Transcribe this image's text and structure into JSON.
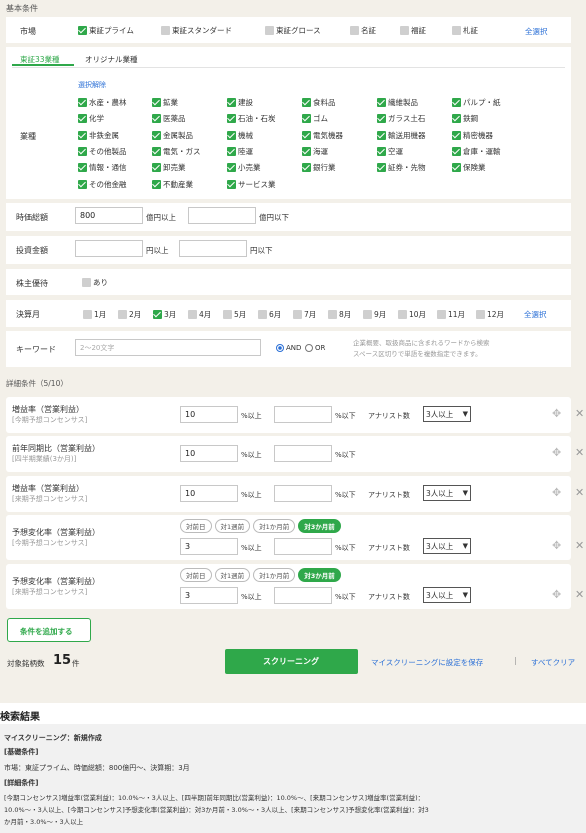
{
  "header": {
    "basic_conditions": "基本条件"
  },
  "market": {
    "label": "市場",
    "options": [
      {
        "label": "東証プライム",
        "checked": true
      },
      {
        "label": "東証スタンダード",
        "checked": false
      },
      {
        "label": "東証グロース",
        "checked": false
      },
      {
        "label": "名証",
        "checked": false
      },
      {
        "label": "福証",
        "checked": false
      },
      {
        "label": "札証",
        "checked": false
      }
    ],
    "select_all": "全選択"
  },
  "industry": {
    "tabs": [
      "東証33業種",
      "オリジナル業種"
    ],
    "deselect": "選択解除",
    "label": "業種",
    "items": [
      "水産・農林",
      "鉱業",
      "建設",
      "食料品",
      "繊維製品",
      "パルプ・紙",
      "化学",
      "医薬品",
      "石油・石炭",
      "ゴム",
      "ガラス土石",
      "鉄鋼",
      "非鉄金属",
      "金属製品",
      "機械",
      "電気機器",
      "輸送用機器",
      "精密機器",
      "その他製品",
      "電気・ガス",
      "陸運",
      "海運",
      "空運",
      "倉庫・運輸",
      "情報・通信",
      "卸売業",
      "小売業",
      "銀行業",
      "証券・先物",
      "保険業",
      "その他金融",
      "不動産業",
      "サービス業"
    ]
  },
  "market_cap": {
    "label": "時価総額",
    "min": "800",
    "min_unit": "億円以上",
    "max": "",
    "max_unit": "億円以下"
  },
  "investment": {
    "label": "投資金額",
    "min_unit": "円以上",
    "max_unit": "円以下"
  },
  "benefit": {
    "label": "株主優待",
    "option": "あり"
  },
  "fiscal_month": {
    "label": "決算月",
    "months": [
      {
        "label": "1月",
        "checked": false
      },
      {
        "label": "2月",
        "checked": false
      },
      {
        "label": "3月",
        "checked": true
      },
      {
        "label": "4月",
        "checked": false
      },
      {
        "label": "5月",
        "checked": false
      },
      {
        "label": "6月",
        "checked": false
      },
      {
        "label": "7月",
        "checked": false
      },
      {
        "label": "8月",
        "checked": false
      },
      {
        "label": "9月",
        "checked": false
      },
      {
        "label": "10月",
        "checked": false
      },
      {
        "label": "11月",
        "checked": false
      },
      {
        "label": "12月",
        "checked": false
      }
    ],
    "select_all": "全選択"
  },
  "keyword": {
    "label": "キーワード",
    "placeholder": "2～20文字",
    "and": "AND",
    "or": "OR",
    "note1": "企業概要、取扱商品に含まれるワードから検索",
    "note2": "スペース区切りで単語を複数指定できます。"
  },
  "details_header": "詳細条件（5/10）",
  "details": [
    {
      "title": "増益率（営業利益）",
      "sub": "[今期予想コンセンサス]",
      "min": "10",
      "min_unit": "%以上",
      "max_unit": "%以下",
      "analyst_label": "アナリスト数",
      "analyst": "3人以上",
      "pills": []
    },
    {
      "title": "前年同期比（営業利益）",
      "sub": "[四半期業績(3か月)]",
      "min": "10",
      "min_unit": "%以上",
      "max_unit": "%以下",
      "analyst_label": "",
      "analyst": "",
      "pills": []
    },
    {
      "title": "増益率（営業利益）",
      "sub": "[来期予想コンセンサス]",
      "min": "10",
      "min_unit": "%以上",
      "max_unit": "%以下",
      "analyst_label": "アナリスト数",
      "analyst": "3人以上",
      "pills": []
    },
    {
      "title": "予想変化率（営業利益）",
      "sub": "[今期予想コンセンサス]",
      "min": "3",
      "min_unit": "%以上",
      "max_unit": "%以下",
      "analyst_label": "アナリスト数",
      "analyst": "3人以上",
      "pills": [
        {
          "label": "対前日",
          "on": false
        },
        {
          "label": "対1週前",
          "on": false
        },
        {
          "label": "対1か月前",
          "on": false
        },
        {
          "label": "対3か月前",
          "on": true
        }
      ]
    },
    {
      "title": "予想変化率（営業利益）",
      "sub": "[来期予想コンセンサス]",
      "min": "3",
      "min_unit": "%以上",
      "max_unit": "%以下",
      "analyst_label": "アナリスト数",
      "analyst": "3人以上",
      "pills": [
        {
          "label": "対前日",
          "on": false
        },
        {
          "label": "対1週前",
          "on": false
        },
        {
          "label": "対1か月前",
          "on": false
        },
        {
          "label": "対3か月前",
          "on": true
        }
      ]
    }
  ],
  "add_condition": "条件を追加する",
  "target_count_label": "対象銘柄数",
  "target_count": "15",
  "target_count_unit": "件",
  "screening_button": "スクリーニング",
  "save_link": "マイスクリーニングに設定を保存",
  "separator": "|",
  "clear_link": "すべてクリア",
  "results": {
    "title": "検索結果",
    "my_screening": "マイスクリーニング：新規作成",
    "basic_head": "[基礎条件]",
    "basic_text": "市場：東証プライム、時価総額：800億円～、決算期：3月",
    "detail_head": "[詳細条件]",
    "detail_line1": "[今期コンセンサス]増益率(営業利益)：10.0%～・3人以上、[四半期]前年同期比(営業利益)：10.0%～、[来期コンセンサス]増益率(営業利益)：",
    "detail_line2": "10.0%～・3人以上、[今期コンセンサス]予想変化率(営業利益)：対3か月前・3.0%～・3人以上、[来期コンセンサス]予想変化率(営業利益)：対3",
    "detail_line3": "か月前・3.0%～・3人以上"
  },
  "colors": {
    "accent": "#2fa84a",
    "link": "#2a6fd6"
  }
}
